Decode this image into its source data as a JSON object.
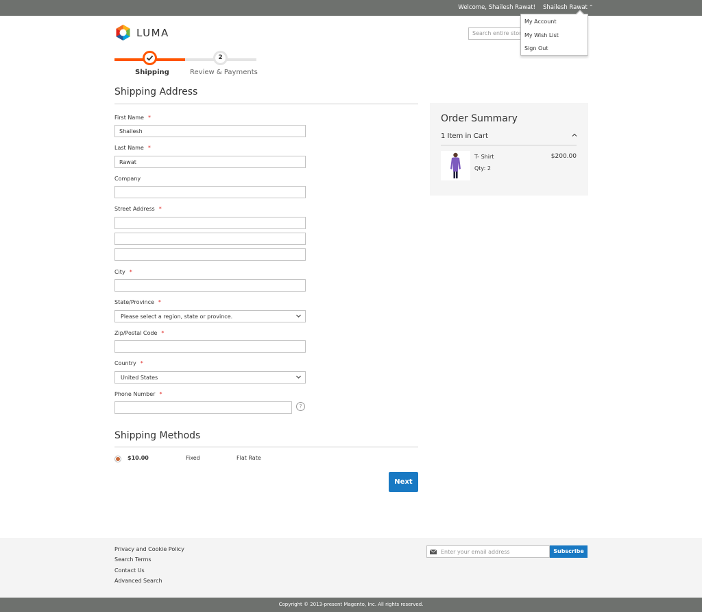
{
  "header": {
    "welcome": "Welcome, Shailesh Rawat!",
    "customer_name": "Shailesh Rawat",
    "menu": [
      "My Account",
      "My Wish List",
      "Sign Out"
    ],
    "logo_text": "LUMA",
    "search_placeholder": "Search entire store"
  },
  "progress": {
    "step1_label": "Shipping",
    "step2_number": "2",
    "step2_label": "Review & Payments"
  },
  "shipping_address": {
    "title": "Shipping Address",
    "first_name_label": "First Name",
    "first_name_value": "Shailesh",
    "last_name_label": "Last Name",
    "last_name_value": "Rawat",
    "company_label": "Company",
    "street_label": "Street Address",
    "city_label": "City",
    "state_label": "State/Province",
    "state_value": "Please select a region, state or province.",
    "zip_label": "Zip/Postal Code",
    "country_label": "Country",
    "country_value": "United States",
    "phone_label": "Phone Number",
    "required_mark": "*",
    "help_mark": "?"
  },
  "shipping_methods": {
    "title": "Shipping Methods",
    "price": "$10.00",
    "method": "Fixed",
    "carrier": "Flat Rate",
    "next_label": "Next"
  },
  "order_summary": {
    "title": "Order Summary",
    "count": "1 Item in Cart",
    "item_name": "T- Shirt",
    "item_qty": "Qty: 2",
    "item_price": "$200.00"
  },
  "footer": {
    "links": [
      "Privacy and Cookie Policy",
      "Search Terms",
      "Contact Us",
      "Advanced Search"
    ],
    "newsletter_placeholder": "Enter your email address",
    "subscribe_label": "Subscribe",
    "copyright": "Copyright © 2013-present Magento, Inc. All rights reserved."
  },
  "colors": {
    "accent": "#ff5501",
    "primary_button": "#1979c3",
    "top_bar": "#6e716e"
  }
}
